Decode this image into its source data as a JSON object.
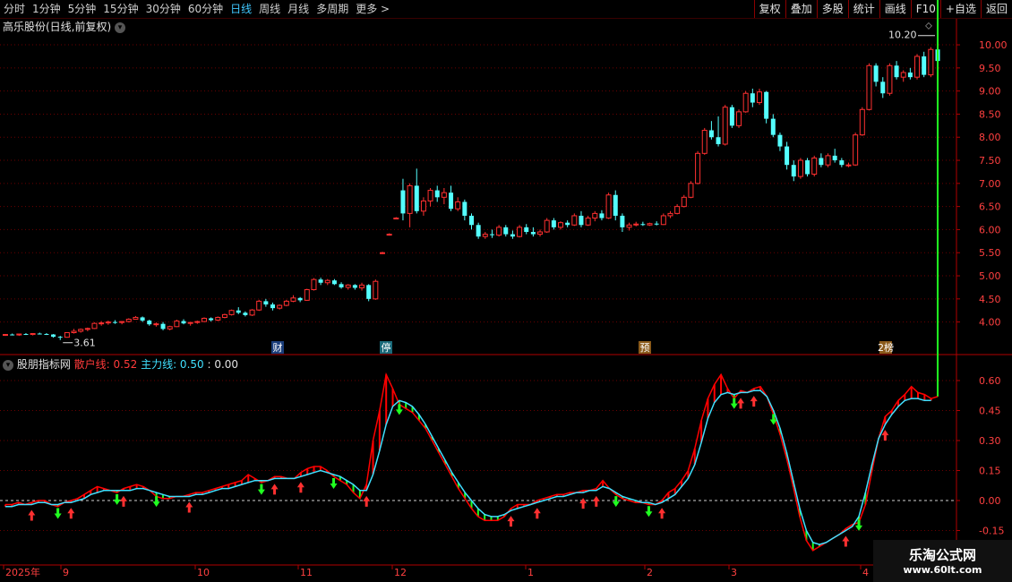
{
  "toolbar": {
    "periods": [
      "分时",
      "1分钟",
      "5分钟",
      "15分钟",
      "30分钟",
      "60分钟",
      "日线",
      "周线",
      "月线",
      "多周期",
      "更多 >"
    ],
    "active_period": "日线",
    "buttons": [
      "复权",
      "叠加",
      "多股",
      "统计",
      "画线",
      "F10",
      "+自选",
      "返回"
    ]
  },
  "stock": {
    "title": "高乐股份(日线,前复权)"
  },
  "indicator": {
    "name": "股朋指标网",
    "line1_label": "散户线: 0.52",
    "line2_label": "主力线: 0.50",
    "extra": ": 0.00"
  },
  "watermark": {
    "line1": "乐淘公式网",
    "line2": "www.60lt.com"
  },
  "colors": {
    "up": "#ff3030",
    "down": "#54ffff",
    "grid": "#6b0000",
    "line1": "#ff0000",
    "line2": "#40e0ff",
    "fill_green": "#20ff20"
  },
  "chart_data": [
    {
      "type": "candlestick",
      "y_ticks": [
        4.0,
        4.5,
        5.0,
        5.5,
        6.0,
        6.5,
        7.0,
        7.5,
        8.0,
        8.5,
        9.0,
        9.5,
        10.0
      ],
      "ylim": [
        3.45,
        10.35
      ],
      "annotations": {
        "high": "10.20",
        "low": "3.61"
      },
      "event_markers": [
        "财",
        "停",
        "预",
        "2榜"
      ],
      "ohlc": [
        [
          3.72,
          3.74,
          3.7,
          3.73
        ],
        [
          3.73,
          3.75,
          3.71,
          3.72
        ],
        [
          3.72,
          3.74,
          3.7,
          3.74
        ],
        [
          3.74,
          3.76,
          3.72,
          3.73
        ],
        [
          3.73,
          3.75,
          3.71,
          3.75
        ],
        [
          3.75,
          3.77,
          3.73,
          3.74
        ],
        [
          3.74,
          3.76,
          3.72,
          3.73
        ],
        [
          3.73,
          3.74,
          3.66,
          3.68
        ],
        [
          3.68,
          3.7,
          3.61,
          3.67
        ],
        [
          3.67,
          3.78,
          3.66,
          3.77
        ],
        [
          3.77,
          3.85,
          3.75,
          3.8
        ],
        [
          3.8,
          3.86,
          3.77,
          3.84
        ],
        [
          3.84,
          3.88,
          3.8,
          3.86
        ],
        [
          3.86,
          3.99,
          3.85,
          3.97
        ],
        [
          3.97,
          4.02,
          3.92,
          3.98
        ],
        [
          3.98,
          4.03,
          3.94,
          4.0
        ],
        [
          4.0,
          4.04,
          3.96,
          3.99
        ],
        [
          3.99,
          4.02,
          3.95,
          4.01
        ],
        [
          4.01,
          4.08,
          3.99,
          4.06
        ],
        [
          4.06,
          4.13,
          4.05,
          4.1
        ],
        [
          4.1,
          4.12,
          4.0,
          4.03
        ],
        [
          4.03,
          4.05,
          3.92,
          3.95
        ],
        [
          3.95,
          3.99,
          3.9,
          3.96
        ],
        [
          3.96,
          4.0,
          3.82,
          3.85
        ],
        [
          3.85,
          3.92,
          3.82,
          3.9
        ],
        [
          3.9,
          4.05,
          3.89,
          4.02
        ],
        [
          4.02,
          4.06,
          3.95,
          3.97
        ],
        [
          3.97,
          4.0,
          3.92,
          3.99
        ],
        [
          3.99,
          4.03,
          3.96,
          4.01
        ],
        [
          4.01,
          4.1,
          4.0,
          4.08
        ],
        [
          4.08,
          4.1,
          4.01,
          4.04
        ],
        [
          4.04,
          4.12,
          4.02,
          4.1
        ],
        [
          4.1,
          4.18,
          4.08,
          4.16
        ],
        [
          4.16,
          4.27,
          4.14,
          4.25
        ],
        [
          4.25,
          4.32,
          4.17,
          4.2
        ],
        [
          4.2,
          4.23,
          4.12,
          4.15
        ],
        [
          4.15,
          4.28,
          4.13,
          4.26
        ],
        [
          4.26,
          4.48,
          4.24,
          4.45
        ],
        [
          4.45,
          4.5,
          4.33,
          4.38
        ],
        [
          4.38,
          4.42,
          4.25,
          4.3
        ],
        [
          4.3,
          4.38,
          4.27,
          4.36
        ],
        [
          4.36,
          4.48,
          4.34,
          4.45
        ],
        [
          4.45,
          4.58,
          4.43,
          4.52
        ],
        [
          4.52,
          4.54,
          4.43,
          4.47
        ],
        [
          4.47,
          4.72,
          4.46,
          4.7
        ],
        [
          4.7,
          4.95,
          4.68,
          4.92
        ],
        [
          4.92,
          4.96,
          4.8,
          4.85
        ],
        [
          4.85,
          4.93,
          4.8,
          4.9
        ],
        [
          4.9,
          4.93,
          4.8,
          4.82
        ],
        [
          4.82,
          4.86,
          4.72,
          4.75
        ],
        [
          4.75,
          4.82,
          4.7,
          4.8
        ],
        [
          4.8,
          4.82,
          4.7,
          4.74
        ],
        [
          4.74,
          4.85,
          4.68,
          4.8
        ],
        [
          4.8,
          4.82,
          4.45,
          4.5
        ],
        [
          4.5,
          4.92,
          4.48,
          4.88
        ],
        [
          5.5,
          5.52,
          5.47,
          5.5
        ],
        [
          5.9,
          5.92,
          5.87,
          5.9
        ],
        [
          6.25,
          6.27,
          6.23,
          6.25
        ],
        [
          6.85,
          7.1,
          6.2,
          6.35
        ],
        [
          6.35,
          7.0,
          6.05,
          6.95
        ],
        [
          6.95,
          7.32,
          6.35,
          6.4
        ],
        [
          6.4,
          6.7,
          6.3,
          6.62
        ],
        [
          6.62,
          6.9,
          6.5,
          6.85
        ],
        [
          6.85,
          6.95,
          6.6,
          6.7
        ],
        [
          6.7,
          6.9,
          6.55,
          6.8
        ],
        [
          6.8,
          6.95,
          6.4,
          6.45
        ],
        [
          6.45,
          6.7,
          6.4,
          6.6
        ],
        [
          6.6,
          6.65,
          6.2,
          6.3
        ],
        [
          6.3,
          6.35,
          6.0,
          6.1
        ],
        [
          6.1,
          6.15,
          5.8,
          5.85
        ],
        [
          5.85,
          5.95,
          5.8,
          5.9
        ],
        [
          5.9,
          6.0,
          5.82,
          5.88
        ],
        [
          5.88,
          6.1,
          5.85,
          6.05
        ],
        [
          6.05,
          6.1,
          5.85,
          5.9
        ],
        [
          5.9,
          5.98,
          5.8,
          5.85
        ],
        [
          5.85,
          6.1,
          5.83,
          6.05
        ],
        [
          6.05,
          6.12,
          5.9,
          5.95
        ],
        [
          5.95,
          6.05,
          5.85,
          5.9
        ],
        [
          5.9,
          6.0,
          5.85,
          5.95
        ],
        [
          5.95,
          6.25,
          5.93,
          6.2
        ],
        [
          6.2,
          6.25,
          6.0,
          6.05
        ],
        [
          6.05,
          6.18,
          6.0,
          6.15
        ],
        [
          6.15,
          6.2,
          6.05,
          6.1
        ],
        [
          6.1,
          6.35,
          6.08,
          6.3
        ],
        [
          6.3,
          6.4,
          6.05,
          6.1
        ],
        [
          6.1,
          6.3,
          6.08,
          6.25
        ],
        [
          6.25,
          6.4,
          6.18,
          6.35
        ],
        [
          6.35,
          6.42,
          6.2,
          6.25
        ],
        [
          6.25,
          6.8,
          6.23,
          6.75
        ],
        [
          6.75,
          6.85,
          6.2,
          6.3
        ],
        [
          6.3,
          6.35,
          5.95,
          6.05
        ],
        [
          6.05,
          6.15,
          5.98,
          6.1
        ],
        [
          6.1,
          6.17,
          6.07,
          6.12
        ],
        [
          6.12,
          6.17,
          6.08,
          6.1
        ],
        [
          6.1,
          6.15,
          6.08,
          6.13
        ],
        [
          6.13,
          6.18,
          6.09,
          6.11
        ],
        [
          6.11,
          6.35,
          6.1,
          6.3
        ],
        [
          6.3,
          6.4,
          6.25,
          6.35
        ],
        [
          6.35,
          6.55,
          6.33,
          6.5
        ],
        [
          6.5,
          6.75,
          6.48,
          6.7
        ],
        [
          6.7,
          7.05,
          6.68,
          7.0
        ],
        [
          7.0,
          7.7,
          6.98,
          7.65
        ],
        [
          7.65,
          8.2,
          7.62,
          8.15
        ],
        [
          8.15,
          8.35,
          7.95,
          8.0
        ],
        [
          8.0,
          8.45,
          7.8,
          7.85
        ],
        [
          7.85,
          8.7,
          7.82,
          8.65
        ],
        [
          8.65,
          8.7,
          8.2,
          8.25
        ],
        [
          8.25,
          8.6,
          8.2,
          8.55
        ],
        [
          8.55,
          9.0,
          8.53,
          8.95
        ],
        [
          8.95,
          9.05,
          8.65,
          8.75
        ],
        [
          8.75,
          9.05,
          8.7,
          8.98
        ],
        [
          8.98,
          9.0,
          8.3,
          8.4
        ],
        [
          8.4,
          8.5,
          8.0,
          8.05
        ],
        [
          8.05,
          8.1,
          7.7,
          7.8
        ],
        [
          7.8,
          7.9,
          7.3,
          7.4
        ],
        [
          7.4,
          7.5,
          7.05,
          7.15
        ],
        [
          7.15,
          7.55,
          7.1,
          7.5
        ],
        [
          7.5,
          7.55,
          7.15,
          7.2
        ],
        [
          7.2,
          7.6,
          7.15,
          7.55
        ],
        [
          7.55,
          7.65,
          7.35,
          7.4
        ],
        [
          7.4,
          7.65,
          7.35,
          7.6
        ],
        [
          7.6,
          7.75,
          7.45,
          7.5
        ],
        [
          7.5,
          7.55,
          7.35,
          7.4
        ],
        [
          7.4,
          7.45,
          7.35,
          7.4
        ],
        [
          7.4,
          8.1,
          7.38,
          8.05
        ],
        [
          8.05,
          8.65,
          8.03,
          8.6
        ],
        [
          8.6,
          9.6,
          8.58,
          9.55
        ],
        [
          9.55,
          9.6,
          9.1,
          9.2
        ],
        [
          9.2,
          9.3,
          8.85,
          8.95
        ],
        [
          8.95,
          9.6,
          8.9,
          9.55
        ],
        [
          9.55,
          9.65,
          9.25,
          9.3
        ],
        [
          9.3,
          9.45,
          9.2,
          9.4
        ],
        [
          9.4,
          9.5,
          9.25,
          9.3
        ],
        [
          9.3,
          9.8,
          9.25,
          9.75
        ],
        [
          9.75,
          9.85,
          9.3,
          9.35
        ],
        [
          9.35,
          9.95,
          9.3,
          9.9
        ],
        [
          9.9,
          10.2,
          9.55,
          9.65
        ]
      ]
    },
    {
      "type": "line",
      "y_ticks": [
        -0.15,
        0.0,
        0.15,
        0.3,
        0.45,
        0.6
      ],
      "ylim": [
        -0.15,
        0.6
      ],
      "x_ticks": [
        "2025年",
        "9",
        "10",
        "11",
        "12",
        "1",
        "2",
        "3",
        "4"
      ],
      "series": [
        {
          "name": "散户线",
          "values": [
            -0.02,
            -0.02,
            -0.01,
            -0.02,
            -0.01,
            0.0,
            0.0,
            -0.02,
            -0.03,
            -0.01,
            0.0,
            0.01,
            0.03,
            0.05,
            0.07,
            0.06,
            0.05,
            0.04,
            0.06,
            0.07,
            0.08,
            0.07,
            0.05,
            0.02,
            0.01,
            0.01,
            0.02,
            0.02,
            0.03,
            0.04,
            0.04,
            0.05,
            0.06,
            0.07,
            0.08,
            0.09,
            0.1,
            0.13,
            0.11,
            0.09,
            0.1,
            0.12,
            0.12,
            0.11,
            0.11,
            0.14,
            0.16,
            0.17,
            0.17,
            0.15,
            0.12,
            0.1,
            0.08,
            0.04,
            0.01,
            0.08,
            0.3,
            0.45,
            0.63,
            0.56,
            0.48,
            0.46,
            0.44,
            0.4,
            0.36,
            0.3,
            0.24,
            0.18,
            0.12,
            0.06,
            0.01,
            -0.04,
            -0.08,
            -0.1,
            -0.1,
            -0.1,
            -0.08,
            -0.04,
            -0.02,
            -0.02,
            -0.02,
            0.0,
            0.01,
            0.02,
            0.03,
            0.03,
            0.04,
            0.04,
            0.05,
            0.05,
            0.06,
            0.1,
            0.06,
            0.03,
            0.01,
            0.0,
            -0.01,
            -0.01,
            -0.02,
            -0.02,
            0.0,
            0.04,
            0.06,
            0.1,
            0.15,
            0.26,
            0.4,
            0.51,
            0.58,
            0.63,
            0.56,
            0.51,
            0.55,
            0.54,
            0.56,
            0.57,
            0.52,
            0.43,
            0.33,
            0.21,
            0.07,
            -0.08,
            -0.2,
            -0.25,
            -0.23,
            -0.21,
            -0.19,
            -0.17,
            -0.14,
            -0.12,
            -0.11,
            -0.02,
            0.15,
            0.31,
            0.42,
            0.45,
            0.5,
            0.53,
            0.57,
            0.54,
            0.53,
            0.51,
            0.52
          ]
        },
        {
          "name": "主力线",
          "values": [
            -0.03,
            -0.03,
            -0.02,
            -0.02,
            -0.02,
            -0.01,
            -0.01,
            -0.02,
            -0.02,
            -0.01,
            -0.01,
            0.0,
            0.01,
            0.03,
            0.04,
            0.05,
            0.05,
            0.05,
            0.05,
            0.05,
            0.06,
            0.06,
            0.05,
            0.04,
            0.03,
            0.02,
            0.02,
            0.02,
            0.02,
            0.03,
            0.03,
            0.04,
            0.05,
            0.06,
            0.06,
            0.07,
            0.08,
            0.09,
            0.1,
            0.1,
            0.1,
            0.11,
            0.11,
            0.11,
            0.11,
            0.12,
            0.13,
            0.14,
            0.15,
            0.14,
            0.13,
            0.12,
            0.1,
            0.08,
            0.05,
            0.05,
            0.13,
            0.25,
            0.38,
            0.47,
            0.5,
            0.49,
            0.47,
            0.43,
            0.38,
            0.32,
            0.26,
            0.2,
            0.14,
            0.09,
            0.04,
            0.0,
            -0.04,
            -0.07,
            -0.08,
            -0.08,
            -0.07,
            -0.05,
            -0.04,
            -0.03,
            -0.02,
            -0.01,
            0.0,
            0.01,
            0.02,
            0.02,
            0.03,
            0.04,
            0.04,
            0.05,
            0.05,
            0.07,
            0.06,
            0.04,
            0.02,
            0.01,
            0.0,
            -0.01,
            -0.01,
            -0.02,
            -0.01,
            0.01,
            0.03,
            0.07,
            0.11,
            0.18,
            0.29,
            0.41,
            0.49,
            0.53,
            0.54,
            0.53,
            0.54,
            0.54,
            0.55,
            0.55,
            0.52,
            0.45,
            0.36,
            0.24,
            0.1,
            -0.04,
            -0.15,
            -0.21,
            -0.22,
            -0.21,
            -0.19,
            -0.17,
            -0.15,
            -0.13,
            -0.08,
            0.04,
            0.18,
            0.31,
            0.38,
            0.43,
            0.47,
            0.5,
            0.51,
            0.51,
            0.5,
            0.5
          ]
        }
      ]
    }
  ]
}
